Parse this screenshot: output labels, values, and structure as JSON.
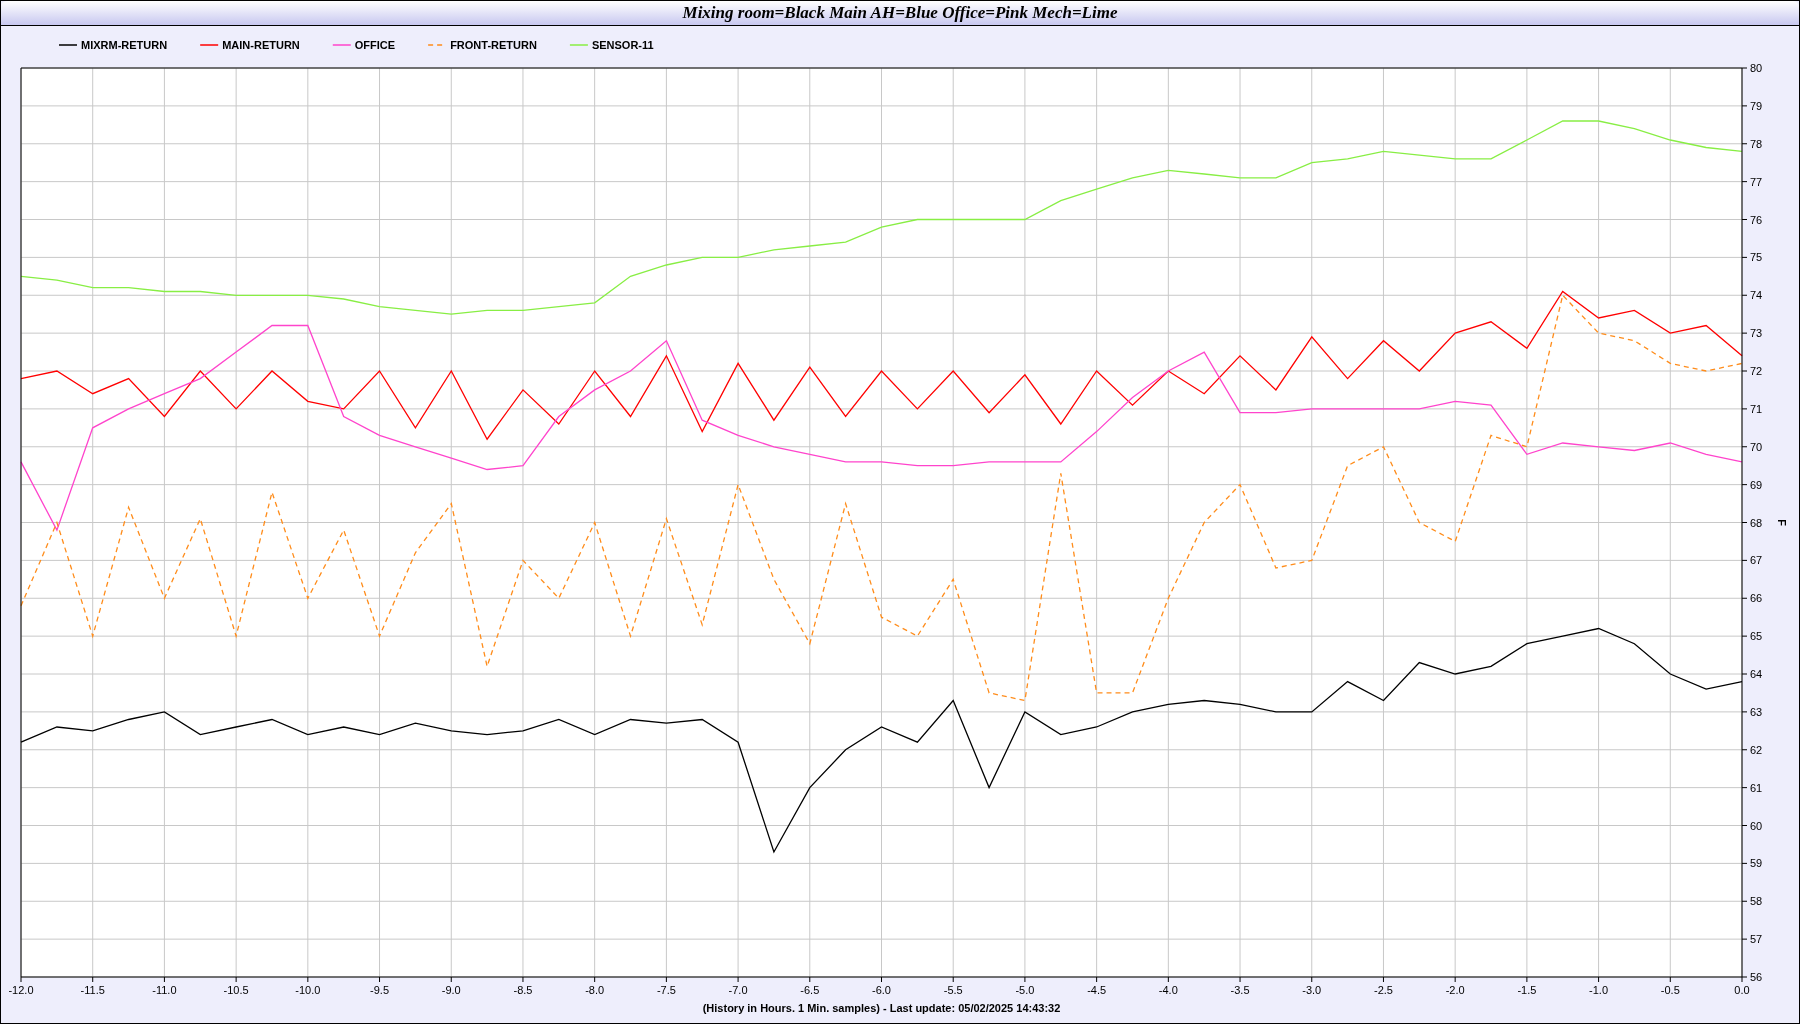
{
  "chart_data": {
    "type": "line",
    "title": "Mixing room=Black Main AH=Blue Office=Pink Mech=Lime",
    "xlabel": "(History in Hours. 1 Min. samples) - Last update: 05/02/2025 14:43:32",
    "ylabel": "F",
    "x": [
      -12,
      -11.75,
      -11.5,
      -11.25,
      -11,
      -10.75,
      -10.5,
      -10.25,
      -10,
      -9.75,
      -9.5,
      -9.25,
      -9,
      -8.75,
      -8.5,
      -8.25,
      -8,
      -7.75,
      -7.5,
      -7.25,
      -7,
      -6.75,
      -6.5,
      -6.25,
      -6,
      -5.75,
      -5.5,
      -5.25,
      -5,
      -4.75,
      -4.5,
      -4.25,
      -4,
      -3.75,
      -3.5,
      -3.25,
      -3,
      -2.75,
      -2.5,
      -2.25,
      -2,
      -1.75,
      -1.5,
      -1.25,
      -1,
      -0.75,
      -0.5,
      -0.25,
      0
    ],
    "series": [
      {
        "name": "MIXRM-RETURN",
        "color": "#000000",
        "line_style": "solid",
        "values": [
          62.2,
          62.6,
          62.5,
          62.8,
          63.0,
          62.4,
          62.6,
          62.8,
          62.4,
          62.6,
          62.4,
          62.7,
          62.5,
          62.4,
          62.5,
          62.8,
          62.4,
          62.8,
          62.7,
          62.8,
          62.2,
          59.3,
          61.0,
          62.0,
          62.6,
          62.2,
          63.3,
          61.0,
          63.0,
          62.4,
          62.6,
          63.0,
          63.2,
          63.3,
          63.2,
          63.0,
          63.0,
          63.8,
          63.3,
          64.3,
          64.0,
          64.2,
          64.8,
          65.0,
          65.2,
          64.8,
          64.0,
          63.6,
          63.8
        ]
      },
      {
        "name": "MAIN-RETURN",
        "color": "#ff0000",
        "line_style": "solid",
        "values": [
          71.8,
          72.0,
          71.4,
          71.8,
          70.8,
          72.0,
          71.0,
          72.0,
          71.2,
          71.0,
          72.0,
          70.5,
          72.0,
          70.2,
          71.5,
          70.6,
          72.0,
          70.8,
          72.4,
          70.4,
          72.2,
          70.7,
          72.1,
          70.8,
          72.0,
          71.0,
          72.0,
          70.9,
          71.9,
          70.6,
          72.0,
          71.1,
          72.0,
          71.4,
          72.4,
          71.5,
          72.9,
          71.8,
          72.8,
          72.0,
          73.0,
          73.3,
          72.6,
          74.1,
          73.4,
          73.6,
          73.0,
          73.2,
          72.4
        ]
      },
      {
        "name": "OFFICE",
        "color": "#ff44cc",
        "line_style": "solid",
        "values": [
          69.6,
          67.8,
          70.5,
          71.0,
          71.4,
          71.8,
          72.5,
          73.2,
          73.2,
          70.8,
          70.3,
          70.0,
          69.7,
          69.4,
          69.5,
          70.8,
          71.5,
          72.0,
          72.8,
          70.7,
          70.3,
          70.0,
          69.8,
          69.6,
          69.6,
          69.5,
          69.5,
          69.6,
          69.6,
          69.6,
          70.4,
          71.3,
          72.0,
          72.5,
          70.9,
          70.9,
          71.0,
          71.0,
          71.0,
          71.0,
          71.2,
          71.1,
          69.8,
          70.1,
          70.0,
          69.9,
          70.1,
          69.8,
          69.6
        ]
      },
      {
        "name": "FRONT-RETURN",
        "color": "#ff8c1a",
        "line_style": "dashed",
        "values": [
          65.8,
          68.0,
          65.0,
          68.4,
          66.0,
          68.1,
          65.0,
          68.8,
          66.0,
          67.8,
          65.0,
          67.2,
          68.5,
          64.2,
          67.0,
          66.0,
          68.0,
          65.0,
          68.1,
          65.3,
          69.0,
          66.5,
          64.8,
          68.5,
          65.5,
          65.0,
          66.5,
          63.5,
          63.3,
          69.3,
          63.5,
          63.5,
          66.0,
          68.0,
          69.0,
          66.8,
          67.0,
          69.5,
          70.0,
          68.0,
          67.5,
          70.3,
          70.0,
          74.0,
          73.0,
          72.8,
          72.2,
          72.0,
          72.2
        ]
      },
      {
        "name": "SENSOR-11",
        "color": "#88ee44",
        "line_style": "solid",
        "values": [
          74.5,
          74.4,
          74.2,
          74.2,
          74.1,
          74.1,
          74.0,
          74.0,
          74.0,
          73.9,
          73.7,
          73.6,
          73.5,
          73.6,
          73.6,
          73.7,
          73.8,
          74.5,
          74.8,
          75.0,
          75.0,
          75.2,
          75.3,
          75.4,
          75.8,
          76.0,
          76.0,
          76.0,
          76.0,
          76.5,
          76.8,
          77.1,
          77.3,
          77.2,
          77.1,
          77.1,
          77.5,
          77.6,
          77.8,
          77.7,
          77.6,
          77.6,
          78.1,
          78.6,
          78.6,
          78.4,
          78.1,
          77.9,
          77.8
        ]
      }
    ],
    "grid": true,
    "legend": true,
    "xlim": [
      -12,
      0
    ],
    "ylim": [
      56,
      80
    ],
    "xticks": [
      {
        "value": -12,
        "label": "-12.0"
      },
      {
        "value": -11.5,
        "label": "-11.5"
      },
      {
        "value": -11,
        "label": "-11.0"
      },
      {
        "value": -10.5,
        "label": "-10.5"
      },
      {
        "value": -10,
        "label": "-10.0"
      },
      {
        "value": -9.5,
        "label": "-9.5"
      },
      {
        "value": -9,
        "label": "-9.0"
      },
      {
        "value": -8.5,
        "label": "-8.5"
      },
      {
        "value": -8,
        "label": "-8.0"
      },
      {
        "value": -7.5,
        "label": "-7.5"
      },
      {
        "value": -7,
        "label": "-7.0"
      },
      {
        "value": -6.5,
        "label": "-6.5"
      },
      {
        "value": -6,
        "label": "-6.0"
      },
      {
        "value": -5.5,
        "label": "-5.5"
      },
      {
        "value": -5,
        "label": "-5.0"
      },
      {
        "value": -4.5,
        "label": "-4.5"
      },
      {
        "value": -4,
        "label": "-4.0"
      },
      {
        "value": -3.5,
        "label": "-3.5"
      },
      {
        "value": -3,
        "label": "-3.0"
      },
      {
        "value": -2.5,
        "label": "-2.5"
      },
      {
        "value": -2,
        "label": "-2.0"
      },
      {
        "value": -1.5,
        "label": "-1.5"
      },
      {
        "value": -1,
        "label": "-1.0"
      },
      {
        "value": -0.5,
        "label": "-0.5"
      },
      {
        "value": 0,
        "label": "0.0"
      }
    ],
    "yticks": [
      56,
      57,
      58,
      59,
      60,
      61,
      62,
      63,
      64,
      65,
      66,
      67,
      68,
      69,
      70,
      71,
      72,
      73,
      74,
      75,
      76,
      77,
      78,
      79,
      80
    ]
  }
}
